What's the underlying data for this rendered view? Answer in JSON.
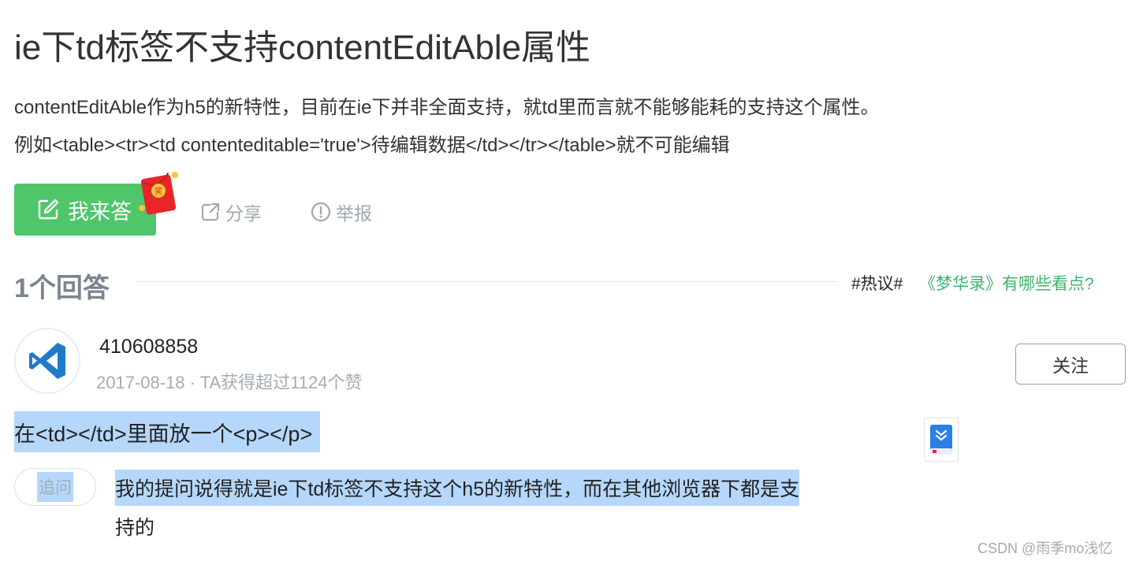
{
  "question": {
    "title": "ie下td标签不支持contentEditAble属性",
    "description_line1": "contentEditAble作为h5的新特性，目前在ie下并非全面支持，就td里而言就不能够能耗的支持这个属性。",
    "description_line2": "例如<table><tr><td contenteditable='true'>待编辑数据</td></tr></table>就不可能编辑"
  },
  "actions": {
    "answer_label": "我来答",
    "redpacket_label": "奖",
    "share_label": "分享",
    "report_label": "举报"
  },
  "answers_section": {
    "count_label": "1个回答",
    "hot_tag": "#热议#",
    "hot_link": "《梦华录》有哪些看点?"
  },
  "answer": {
    "username": "410608858",
    "meta": "2017-08-18 · TA获得超过1124个赞",
    "follow_label": "关注",
    "content": "在<td></td>里面放一个<p></p>"
  },
  "followup": {
    "badge": "追问",
    "line1": "我的提问说得就是ie下td标签不支持这个h5的新特性，而在其他浏览器下都是支",
    "line2": "持的"
  },
  "watermark": "CSDN @雨季mo浅忆",
  "colors": {
    "accent_green": "#4fc66a",
    "link_green": "#3fb36b",
    "selection_blue": "#b5d7fb",
    "vscode_blue": "#1f7acc"
  },
  "icons": {
    "answer": "edit-icon",
    "share": "share-icon",
    "report": "report-icon",
    "avatar": "vscode-logo-icon",
    "book": "book-icon"
  }
}
